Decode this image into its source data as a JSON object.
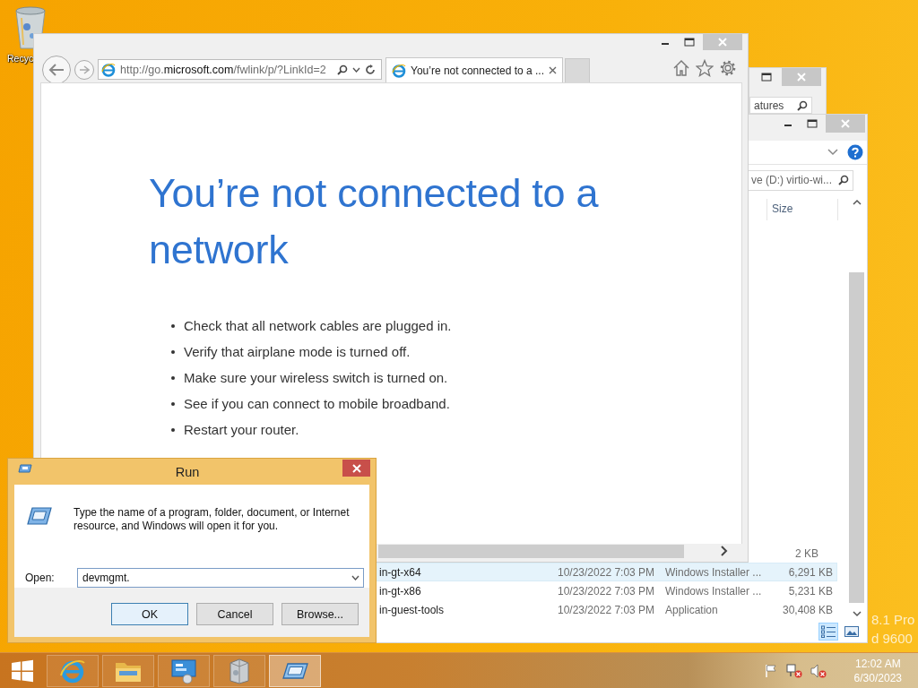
{
  "desktop": {
    "icons": [
      {
        "label": "Recyc"
      }
    ],
    "watermark": [
      "8.1 Pro",
      "d 9600"
    ]
  },
  "explorer_back": {
    "search": {
      "value": "atures"
    }
  },
  "explorer_front": {
    "search": {
      "value": "ve (D:) virtio-wi..."
    },
    "columns": [
      "Size"
    ],
    "rows": [
      {
        "size": "2 KB",
        "selected": false
      },
      {
        "name": "in-gt-x64",
        "date": "10/23/2022 7:03 PM",
        "type": "Windows Installer ...",
        "size": "6,291 KB",
        "selected": true
      },
      {
        "name": "in-gt-x86",
        "date": "10/23/2022 7:03 PM",
        "type": "Windows Installer ...",
        "size": "5,231 KB",
        "selected": false
      },
      {
        "name": "in-guest-tools",
        "date": "10/23/2022 7:03 PM",
        "type": "Application",
        "size": "30,408 KB",
        "selected": false
      }
    ],
    "views": [
      {
        "kind": "details",
        "selected": true
      },
      {
        "kind": "preview",
        "selected": false
      }
    ]
  },
  "browser": {
    "address": "http://go.**microsoft.com**/fwlink/p/?LinkId=2",
    "tabs": [
      {
        "label": "You’re not connected to a ...",
        "selected": true
      }
    ],
    "heading": "You’re not connected to a network",
    "bullets": [
      "Check that all network cables are plugged in.",
      "Verify that airplane mode is turned off.",
      "Make sure your wireless switch is turned on.",
      "See if you can connect to mobile broadband.",
      "Restart your router."
    ]
  },
  "run_dialog": {
    "title": "Run",
    "description": "Type the name of a program, folder, document, or Internet resource, and Windows will open it for you.",
    "open_label": "Open:",
    "value": "devmgmt.",
    "buttons": [
      "OK",
      "Cancel",
      "Browse..."
    ]
  },
  "taskbar": {
    "apps": [
      {
        "kind": "browser",
        "selected": false
      },
      {
        "kind": "files",
        "selected": false
      },
      {
        "kind": "control",
        "selected": false
      },
      {
        "kind": "installer",
        "selected": false
      },
      {
        "kind": "run",
        "selected": true
      }
    ],
    "time": "12:02 AM",
    "date": "6/30/2023"
  }
}
